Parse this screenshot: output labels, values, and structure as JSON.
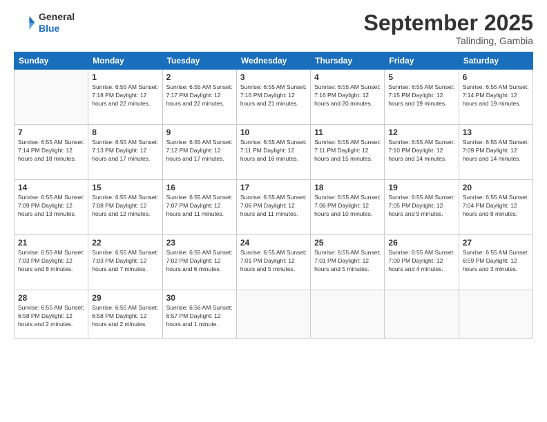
{
  "logo": {
    "line1": "General",
    "line2": "Blue"
  },
  "title": "September 2025",
  "subtitle": "Talinding, Gambia",
  "days_of_week": [
    "Sunday",
    "Monday",
    "Tuesday",
    "Wednesday",
    "Thursday",
    "Friday",
    "Saturday"
  ],
  "weeks": [
    [
      {
        "day": "",
        "info": ""
      },
      {
        "day": "1",
        "info": "Sunrise: 6:55 AM\nSunset: 7:18 PM\nDaylight: 12 hours\nand 22 minutes."
      },
      {
        "day": "2",
        "info": "Sunrise: 6:55 AM\nSunset: 7:17 PM\nDaylight: 12 hours\nand 22 minutes."
      },
      {
        "day": "3",
        "info": "Sunrise: 6:55 AM\nSunset: 7:16 PM\nDaylight: 12 hours\nand 21 minutes."
      },
      {
        "day": "4",
        "info": "Sunrise: 6:55 AM\nSunset: 7:16 PM\nDaylight: 12 hours\nand 20 minutes."
      },
      {
        "day": "5",
        "info": "Sunrise: 6:55 AM\nSunset: 7:15 PM\nDaylight: 12 hours\nand 19 minutes."
      },
      {
        "day": "6",
        "info": "Sunrise: 6:55 AM\nSunset: 7:14 PM\nDaylight: 12 hours\nand 19 minutes."
      }
    ],
    [
      {
        "day": "7",
        "info": "Sunrise: 6:55 AM\nSunset: 7:14 PM\nDaylight: 12 hours\nand 18 minutes."
      },
      {
        "day": "8",
        "info": "Sunrise: 6:55 AM\nSunset: 7:13 PM\nDaylight: 12 hours\nand 17 minutes."
      },
      {
        "day": "9",
        "info": "Sunrise: 6:55 AM\nSunset: 7:12 PM\nDaylight: 12 hours\nand 17 minutes."
      },
      {
        "day": "10",
        "info": "Sunrise: 6:55 AM\nSunset: 7:11 PM\nDaylight: 12 hours\nand 16 minutes."
      },
      {
        "day": "11",
        "info": "Sunrise: 6:55 AM\nSunset: 7:11 PM\nDaylight: 12 hours\nand 15 minutes."
      },
      {
        "day": "12",
        "info": "Sunrise: 6:55 AM\nSunset: 7:10 PM\nDaylight: 12 hours\nand 14 minutes."
      },
      {
        "day": "13",
        "info": "Sunrise: 6:55 AM\nSunset: 7:09 PM\nDaylight: 12 hours\nand 14 minutes."
      }
    ],
    [
      {
        "day": "14",
        "info": "Sunrise: 6:55 AM\nSunset: 7:09 PM\nDaylight: 12 hours\nand 13 minutes."
      },
      {
        "day": "15",
        "info": "Sunrise: 6:55 AM\nSunset: 7:08 PM\nDaylight: 12 hours\nand 12 minutes."
      },
      {
        "day": "16",
        "info": "Sunrise: 6:55 AM\nSunset: 7:07 PM\nDaylight: 12 hours\nand 11 minutes."
      },
      {
        "day": "17",
        "info": "Sunrise: 6:55 AM\nSunset: 7:06 PM\nDaylight: 12 hours\nand 11 minutes."
      },
      {
        "day": "18",
        "info": "Sunrise: 6:55 AM\nSunset: 7:06 PM\nDaylight: 12 hours\nand 10 minutes."
      },
      {
        "day": "19",
        "info": "Sunrise: 6:55 AM\nSunset: 7:05 PM\nDaylight: 12 hours\nand 9 minutes."
      },
      {
        "day": "20",
        "info": "Sunrise: 6:55 AM\nSunset: 7:04 PM\nDaylight: 12 hours\nand 8 minutes."
      }
    ],
    [
      {
        "day": "21",
        "info": "Sunrise: 6:55 AM\nSunset: 7:03 PM\nDaylight: 12 hours\nand 8 minutes."
      },
      {
        "day": "22",
        "info": "Sunrise: 6:55 AM\nSunset: 7:03 PM\nDaylight: 12 hours\nand 7 minutes."
      },
      {
        "day": "23",
        "info": "Sunrise: 6:55 AM\nSunset: 7:02 PM\nDaylight: 12 hours\nand 6 minutes."
      },
      {
        "day": "24",
        "info": "Sunrise: 6:55 AM\nSunset: 7:01 PM\nDaylight: 12 hours\nand 5 minutes."
      },
      {
        "day": "25",
        "info": "Sunrise: 6:55 AM\nSunset: 7:01 PM\nDaylight: 12 hours\nand 5 minutes."
      },
      {
        "day": "26",
        "info": "Sunrise: 6:55 AM\nSunset: 7:00 PM\nDaylight: 12 hours\nand 4 minutes."
      },
      {
        "day": "27",
        "info": "Sunrise: 6:55 AM\nSunset: 6:59 PM\nDaylight: 12 hours\nand 3 minutes."
      }
    ],
    [
      {
        "day": "28",
        "info": "Sunrise: 6:55 AM\nSunset: 6:58 PM\nDaylight: 12 hours\nand 2 minutes."
      },
      {
        "day": "29",
        "info": "Sunrise: 6:55 AM\nSunset: 6:58 PM\nDaylight: 12 hours\nand 2 minutes."
      },
      {
        "day": "30",
        "info": "Sunrise: 6:56 AM\nSunset: 6:57 PM\nDaylight: 12 hours\nand 1 minute."
      },
      {
        "day": "",
        "info": ""
      },
      {
        "day": "",
        "info": ""
      },
      {
        "day": "",
        "info": ""
      },
      {
        "day": "",
        "info": ""
      }
    ]
  ]
}
